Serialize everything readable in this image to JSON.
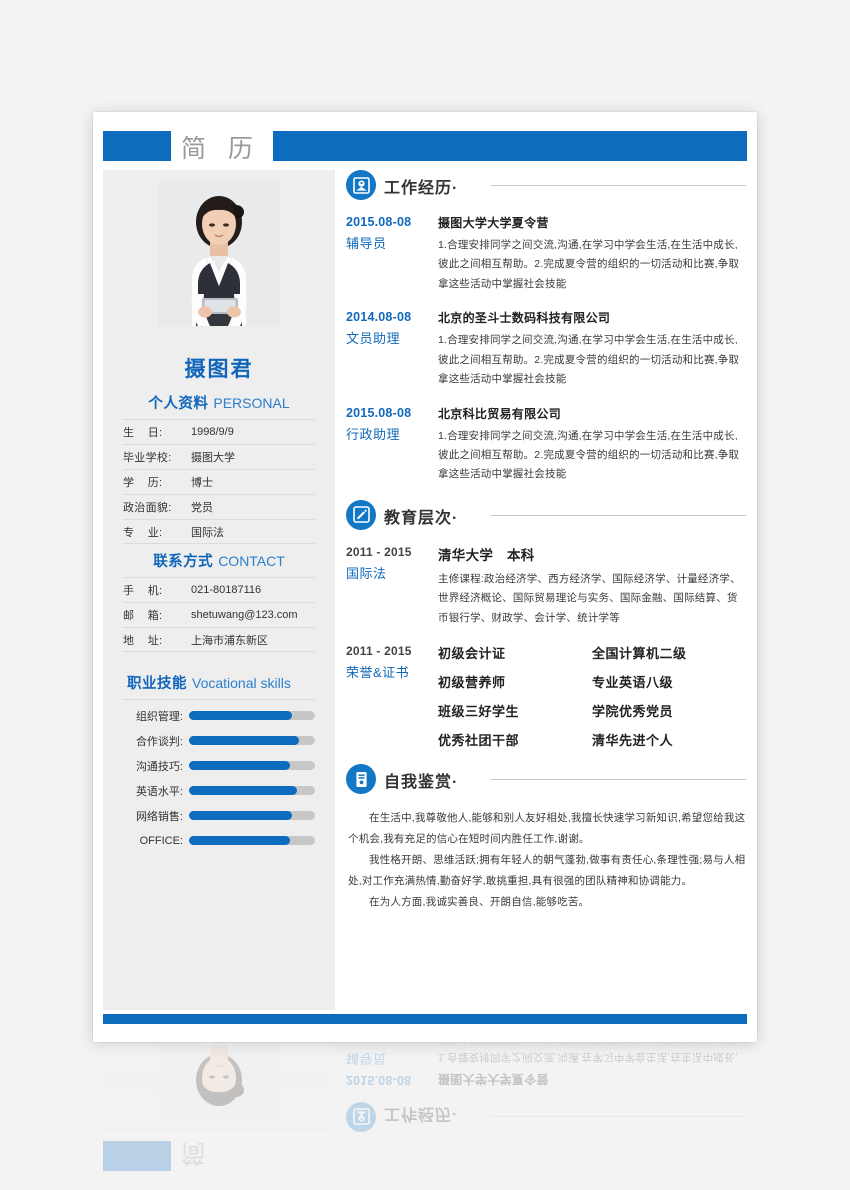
{
  "theme": {
    "accent": "#0d6cbe",
    "accent_light": "#1277c4",
    "link_blue": "#1168bb",
    "sidebar_bg": "#eeeeee",
    "page_bg": "#f3f3f3",
    "text": "#333333",
    "rule": "#c9c9c9"
  },
  "header": {
    "title": "简 历"
  },
  "sidebar": {
    "photo_alt": "portrait-photo",
    "name": "摄图君",
    "personal": {
      "title_cn": "个人资料",
      "title_en": "PERSONAL",
      "rows": [
        {
          "label": "生    日:",
          "value": "1998/9/9"
        },
        {
          "label": "毕业学校:",
          "value": "摄图大学"
        },
        {
          "label": "学    历:",
          "value": "博士"
        },
        {
          "label": "政治面貌:",
          "value": "党员"
        },
        {
          "label": "专    业:",
          "value": "国际法"
        }
      ]
    },
    "contact": {
      "title_cn": "联系方式",
      "title_en": "CONTACT",
      "rows": [
        {
          "label": "手    机:",
          "value": "021-80187116"
        },
        {
          "label": "邮    箱:",
          "value": "shetuwang@123.com"
        },
        {
          "label": "地    址:",
          "value": "上海市浦东新区"
        }
      ]
    },
    "skills": {
      "title_cn": "职业技能",
      "title_en": "Vocational skills",
      "items": [
        {
          "label": "组织管理:",
          "percent": 82
        },
        {
          "label": "合作谈判:",
          "percent": 87
        },
        {
          "label": "沟通技巧:",
          "percent": 80
        },
        {
          "label": "英语水平:",
          "percent": 86
        },
        {
          "label": "网络销售:",
          "percent": 82
        },
        {
          "label": "OFFICE:",
          "percent": 80
        }
      ]
    }
  },
  "main": {
    "work": {
      "icon": "inbox-download-icon",
      "title": "工作经历",
      "dot": "·",
      "entries": [
        {
          "date": "2015.08-08",
          "role": "辅导员",
          "org": "摄图大学大学夏令营",
          "desc": "1.合理安排同学之间交流,沟通,在学习中学会生活,在生活中成长,彼此之间相互帮助。2.完成夏令营的组织的一切活动和比赛,争取拿这些活动中掌握社会技能"
        },
        {
          "date": "2014.08-08",
          "role": "文员助理",
          "org": "北京的圣斗士数码科技有限公司",
          "desc": "1.合理安排同学之间交流,沟通,在学习中学会生活,在生活中成长,彼此之间相互帮助。2.完成夏令营的组织的一切活动和比赛,争取拿这些活动中掌握社会技能"
        },
        {
          "date": "2015.08-08",
          "role": "行政助理",
          "org": "北京科比贸易有限公司",
          "desc": "1.合理安排同学之间交流,沟通,在学习中学会生活,在生活中成长,彼此之间相互帮助。2.完成夏令营的组织的一切活动和比赛,争取拿这些活动中掌握社会技能"
        }
      ]
    },
    "education": {
      "icon": "edit-document-icon",
      "title": "教育层次",
      "dot": "·",
      "entry": {
        "date": "2011 - 2015",
        "role": "国际法",
        "org": "清华大学　本科",
        "desc": "主修课程:政治经济学、西方经济学、国际经济学、计量经济学、世界经济概论、国际贸易理论与实务、国际金融、国际结算、货币银行学、财政学、会计学、统计学等"
      },
      "certs": {
        "date": "2011 - 2015",
        "role": "荣誉&证书",
        "items": [
          "初级会计证",
          "全国计算机二级",
          "初级营养师",
          "专业英语八级",
          "班级三好学生",
          "学院优秀党员",
          "优秀社团干部",
          "清华先进个人"
        ]
      }
    },
    "about": {
      "icon": "document-lines-icon",
      "title": "自我鉴赏",
      "dot": "·",
      "paragraphs": [
        "在生活中,我尊敬他人,能够和别人友好相处,我擅长快速学习新知识,希望您给我这个机会,我有充足的信心在短时间内胜任工作,谢谢。",
        "我性格开朗、思维活跃;拥有年轻人的朝气蓬勃,做事有责任心,条理性强;易与人相处,对工作充满热情,勤奋好学,敢挑重担,具有很强的团队精神和协调能力。",
        "在为人方面,我诚实善良、开朗自信,能够吃苦。"
      ]
    }
  }
}
